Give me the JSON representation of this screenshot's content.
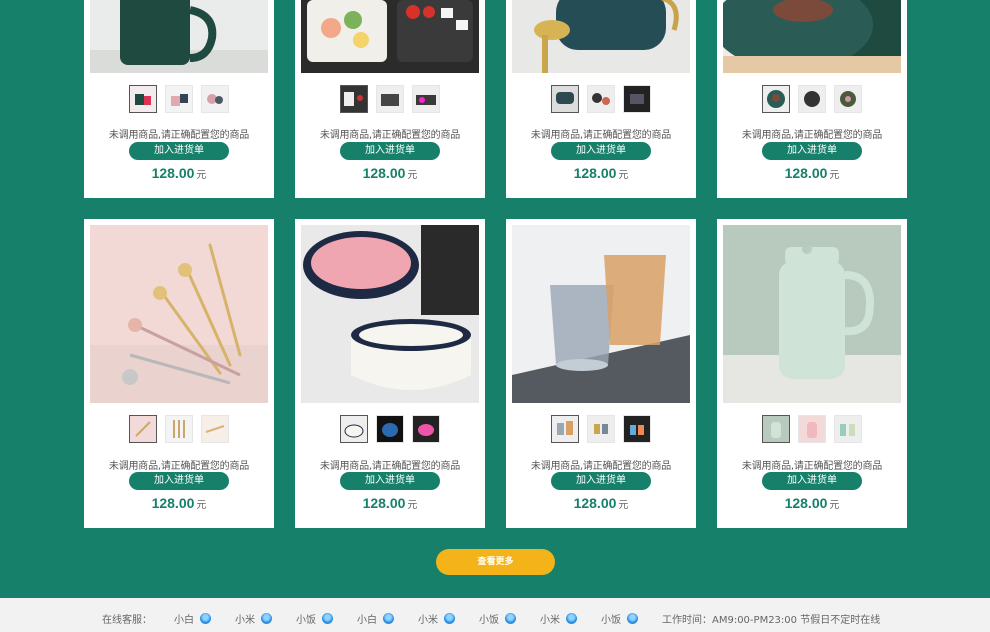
{
  "product_cards": [
    {
      "hint": "未调用商品,请正确配置您的商品",
      "add_label": "加入进货单",
      "price": "128.00",
      "unit": "元",
      "image": "mug-with-spoon"
    },
    {
      "hint": "未调用商品,请正确配置您的商品",
      "add_label": "加入进货单",
      "price": "128.00",
      "unit": "元",
      "image": "bento-box"
    },
    {
      "hint": "未调用商品,请正确配置您的商品",
      "add_label": "加入进货单",
      "price": "128.00",
      "unit": "元",
      "image": "cup-gold-spoon"
    },
    {
      "hint": "未调用商品,请正确配置您的商品",
      "add_label": "加入进货单",
      "price": "128.00",
      "unit": "元",
      "image": "steak-plate"
    },
    {
      "hint": "未调用商品,请正确配置您的商品",
      "add_label": "加入进货单",
      "price": "128.00",
      "unit": "元",
      "image": "flower-forks"
    },
    {
      "hint": "未调用商品,请正确配置您的商品",
      "add_label": "加入进货单",
      "price": "128.00",
      "unit": "元",
      "image": "ceramic-bowls"
    },
    {
      "hint": "未调用商品,请正确配置您的商品",
      "add_label": "加入进货单",
      "price": "128.00",
      "unit": "元",
      "image": "glass-tumblers"
    },
    {
      "hint": "未调用商品,请正确配置您的商品",
      "add_label": "加入进货单",
      "price": "128.00",
      "unit": "元",
      "image": "thermos-pitcher"
    }
  ],
  "more_button": "查看更多",
  "footer": {
    "service_label": "在线客服：",
    "agents": [
      "小白",
      "小米",
      "小饭",
      "小白",
      "小米",
      "小饭",
      "小米",
      "小饭"
    ],
    "hours": "工作时间：AM9:00-PM23:00 节假日不定时在线"
  },
  "colors": {
    "brand": "#16806a",
    "accent": "#f5b31a"
  }
}
